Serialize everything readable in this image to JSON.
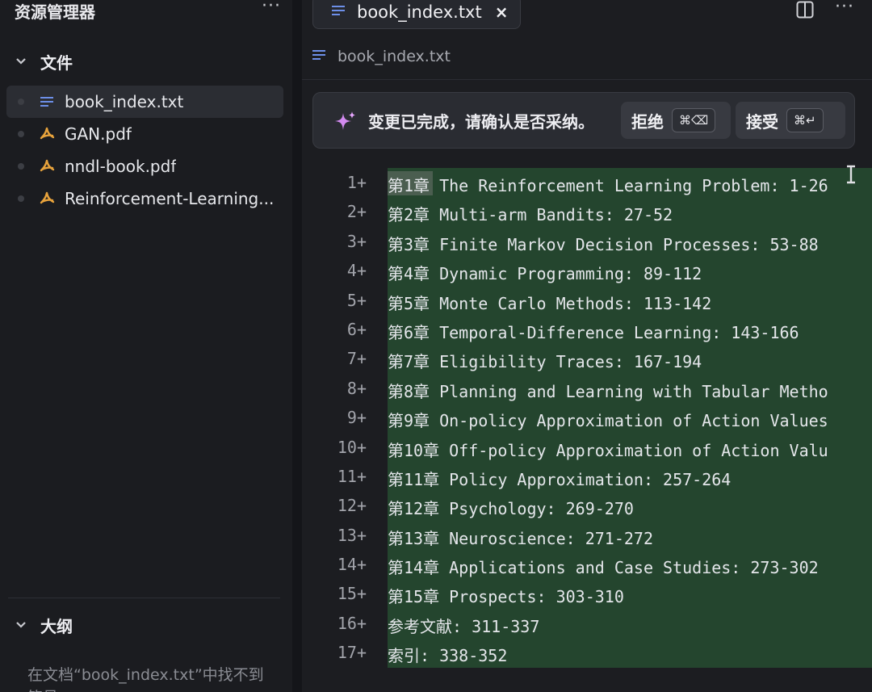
{
  "sidebar": {
    "title": "资源管理器",
    "more": "···",
    "files_section": "文件",
    "files": [
      {
        "name": "book_index.txt",
        "type": "text",
        "active": true
      },
      {
        "name": "GAN.pdf",
        "type": "pdf",
        "active": false
      },
      {
        "name": "nndl-book.pdf",
        "type": "pdf",
        "active": false
      },
      {
        "name": "Reinforcement-Learning...",
        "type": "pdf",
        "active": false
      }
    ],
    "outline_section": "大纲",
    "outline_message": "在文档“book_index.txt”中找不到符号"
  },
  "editor": {
    "tab_label": "book_index.txt",
    "tab_close": "×",
    "more": "···",
    "breadcrumb": "book_index.txt",
    "banner": {
      "message": "变更已完成，请确认是否采纳。",
      "reject_label": "拒绝",
      "reject_shortcut": "⌘⌫",
      "accept_label": "接受",
      "accept_shortcut": "⌘↵"
    },
    "lines": [
      {
        "num": "1+",
        "text": "第1章 The Reinforcement Learning Problem: 1-26"
      },
      {
        "num": "2+",
        "text": "第2章 Multi-arm Bandits: 27-52"
      },
      {
        "num": "3+",
        "text": "第3章 Finite Markov Decision Processes: 53-88"
      },
      {
        "num": "4+",
        "text": "第4章 Dynamic Programming: 89-112"
      },
      {
        "num": "5+",
        "text": "第5章 Monte Carlo Methods: 113-142"
      },
      {
        "num": "6+",
        "text": "第6章 Temporal-Difference Learning: 143-166"
      },
      {
        "num": "7+",
        "text": "第7章 Eligibility Traces: 167-194"
      },
      {
        "num": "8+",
        "text": "第8章 Planning and Learning with Tabular Metho"
      },
      {
        "num": "9+",
        "text": "第9章 On-policy Approximation of Action Values"
      },
      {
        "num": "10+",
        "text": "第10章 Off-policy Approximation of Action Valu"
      },
      {
        "num": "11+",
        "text": "第11章 Policy Approximation: 257-264"
      },
      {
        "num": "12+",
        "text": "第12章 Psychology: 269-270"
      },
      {
        "num": "13+",
        "text": "第13章 Neuroscience: 271-272"
      },
      {
        "num": "14+",
        "text": "第14章 Applications and Case Studies: 273-302"
      },
      {
        "num": "15+",
        "text": "第15章 Prospects: 303-310"
      },
      {
        "num": "16+",
        "text": "参考文献: 311-337"
      },
      {
        "num": "17+",
        "text": "索引: 338-352"
      }
    ]
  },
  "colors": {
    "added_line_bg": "#24452e",
    "pdf_icon": "#e8a33c",
    "text_icon": "#6d8fe8",
    "sparkle": "#d38bf0"
  }
}
